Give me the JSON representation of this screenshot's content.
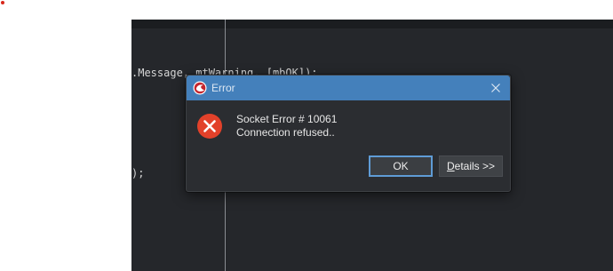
{
  "editor": {
    "code_line_1": ".Message, mtWarning, [mbOK]);",
    "code_line_2": ");"
  },
  "dialog": {
    "title": "Error",
    "app_icon": "delphi-app-icon",
    "close_icon": "close-icon",
    "error_icon": "error-circle-x-icon",
    "message_line_1": "Socket Error # 10061",
    "message_line_2": "Connection refused..",
    "ok_label": "OK",
    "details_label_first": "D",
    "details_label_rest": "etails >>"
  },
  "colors": {
    "titlebar": "#4480bb",
    "dialog_bg": "#2b2d31",
    "editor_bg": "#25272b",
    "error_red": "#e2412a",
    "ok_focus_border": "#5f9cd6"
  }
}
